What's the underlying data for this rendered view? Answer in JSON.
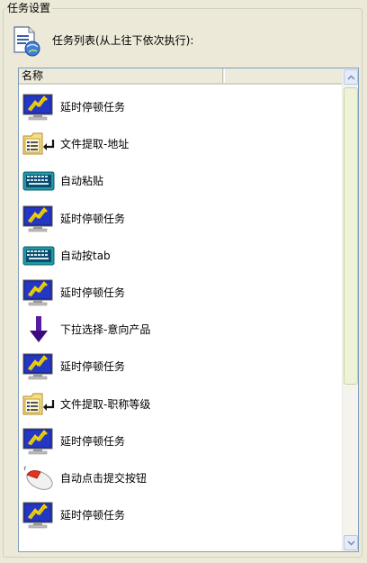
{
  "group": {
    "title": "任务设置"
  },
  "header": {
    "label": "任务列表(从上往下依次执行):",
    "icon": "task-list-icon"
  },
  "list": {
    "column_header": "名称",
    "items": [
      {
        "label": "延时停顿任务",
        "icon": "delay-monitor-icon"
      },
      {
        "label": "文件提取-地址",
        "icon": "file-extract-icon"
      },
      {
        "label": "自动粘贴",
        "icon": "keyboard-icon"
      },
      {
        "label": "延时停顿任务",
        "icon": "delay-monitor-icon"
      },
      {
        "label": "自动按tab",
        "icon": "keyboard-icon"
      },
      {
        "label": "延时停顿任务",
        "icon": "delay-monitor-icon"
      },
      {
        "label": "下拉选择-意向产品",
        "icon": "down-arrow-icon"
      },
      {
        "label": "延时停顿任务",
        "icon": "delay-monitor-icon"
      },
      {
        "label": "文件提取-职称等级",
        "icon": "file-extract-icon"
      },
      {
        "label": "延时停顿任务",
        "icon": "delay-monitor-icon"
      },
      {
        "label": "自动点击提交按钮",
        "icon": "mouse-click-icon"
      },
      {
        "label": "延时停顿任务",
        "icon": "delay-monitor-icon"
      }
    ]
  }
}
